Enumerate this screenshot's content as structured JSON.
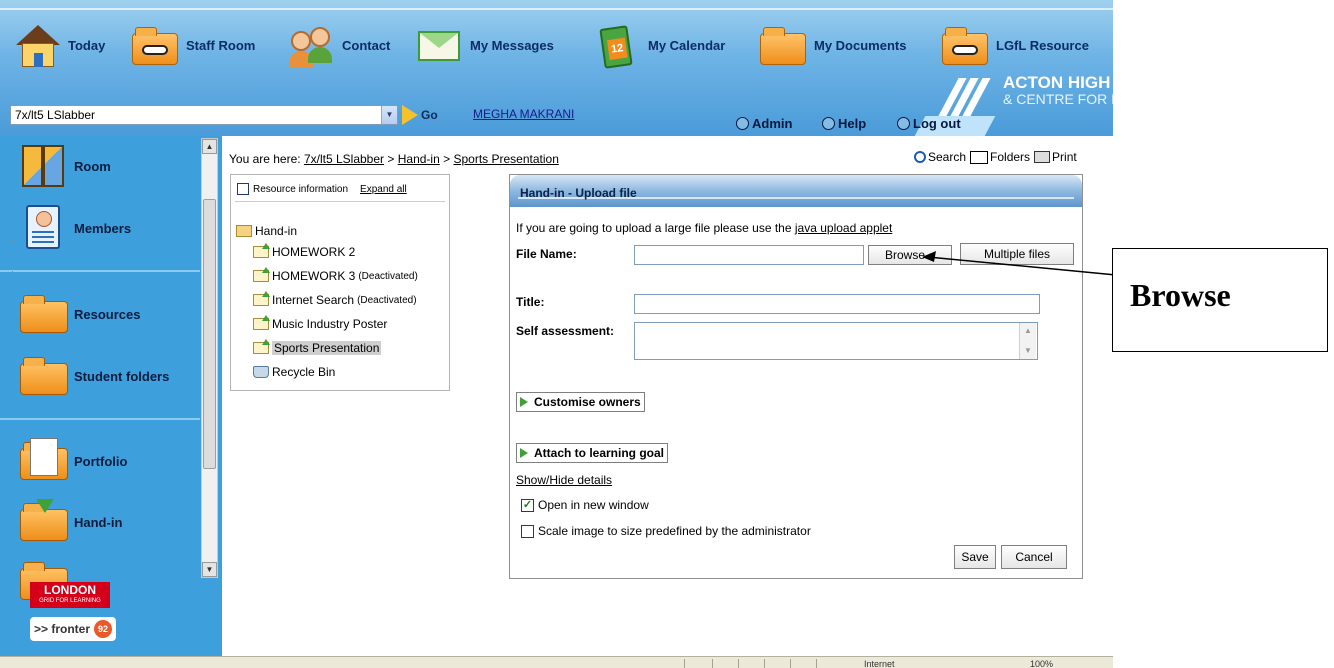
{
  "nav": {
    "items": [
      {
        "label": "Today",
        "icon": "house-icon"
      },
      {
        "label": "Staff Room",
        "icon": "folder-glasses-icon"
      },
      {
        "label": "Contact",
        "icon": "people-icon"
      },
      {
        "label": "My Messages",
        "icon": "envelope-icon"
      },
      {
        "label": "My Calendar",
        "icon": "calendar-icon"
      },
      {
        "label": "My Documents",
        "icon": "folder-person-icon"
      },
      {
        "label": "LGfL Resource",
        "icon": "folder-glasses-icon"
      }
    ],
    "calendar_number": "12"
  },
  "school": {
    "name_line1": "ACTON HIGH",
    "name_line2": "& CENTRE FOR M"
  },
  "class_selector": {
    "value": "7x/lt5 LSlabber",
    "go_label": "Go"
  },
  "user": {
    "name": "MEGHA MAKRANI"
  },
  "top_options": [
    "Admin",
    "Help",
    "Log out"
  ],
  "sidebar": {
    "items": [
      "Room",
      "Members",
      "Resources",
      "Student folders",
      "Portfolio",
      "Hand-in"
    ],
    "logos": {
      "london": "LONDON",
      "london_sub": "GRID FOR LEARNING",
      "fronter": ">> fronter",
      "fronter_num": "92"
    }
  },
  "breadcrumb": {
    "prefix": "You are here:",
    "items": [
      "7x/lt5 LSlabber",
      "Hand-in",
      "Sports Presentation"
    ],
    "sep": ">"
  },
  "toolbar": {
    "search": "Search",
    "folders": "Folders",
    "print": "Print"
  },
  "tree": {
    "resource_info": "Resource information",
    "expand_all": "Expand all",
    "root": "Hand-in",
    "items": [
      {
        "label": "HOMEWORK 2",
        "note": ""
      },
      {
        "label": "HOMEWORK 3",
        "note": "(Deactivated)"
      },
      {
        "label": "Internet Search",
        "note": "(Deactivated)"
      },
      {
        "label": "Music Industry Poster",
        "note": ""
      },
      {
        "label": "Sports Presentation",
        "note": ""
      }
    ],
    "recycle": "Recycle Bin"
  },
  "upload": {
    "title": "Hand-in - Upload file",
    "large_file_text": "If you are going to upload a large file please use the",
    "applet_link": "java upload applet",
    "file_name_label": "File Name:",
    "file_name_value": "",
    "browse_label": "Browse...",
    "multiple_label": "Multiple files",
    "title_label": "Title:",
    "title_value": "",
    "self_assessment_label": "Self assessment:",
    "customise_owners": "Customise owners",
    "attach_goal": "Attach to learning goal",
    "show_hide": "Show/Hide details",
    "open_new_window": "Open in new window",
    "open_new_window_checked": true,
    "scale_image": "Scale image to size predefined by the administrator",
    "scale_image_checked": false,
    "save_label": "Save",
    "cancel_label": "Cancel"
  },
  "callout": {
    "text": "Browse"
  },
  "statusbar": {
    "zone": "Internet",
    "zoom": "100%"
  }
}
